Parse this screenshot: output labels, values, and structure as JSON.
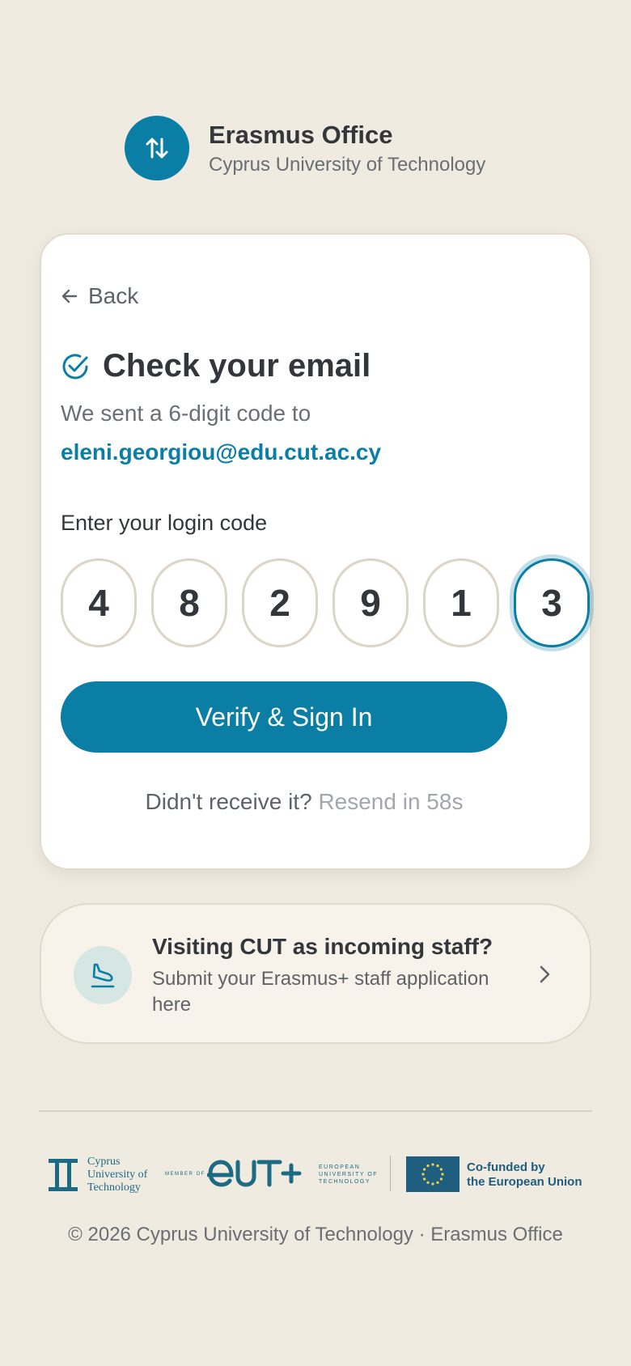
{
  "header": {
    "title": "Erasmus Office",
    "subtitle": "Cyprus University of Technology",
    "logo_icon": "arrows-up-down-icon"
  },
  "card": {
    "back_label": "Back",
    "heading": "Check your email",
    "sent_text": "We sent a 6-digit code to",
    "email": "eleni.georgiou@edu.cut.ac.cy",
    "code_label": "Enter your login code",
    "digits": [
      "4",
      "8",
      "2",
      "9",
      "1",
      "3"
    ],
    "active_digit_index": 5,
    "verify_label": "Verify & Sign In",
    "resend_prompt": "Didn't receive it?",
    "resend_timer": "Resend in 58s"
  },
  "staff_card": {
    "title": "Visiting CUT as incoming staff?",
    "description": "Submit your Erasmus+ staff application here",
    "icon": "plane-landing-icon"
  },
  "footer": {
    "cut_logo_lines": [
      "Cyprus",
      "University of",
      "Technology"
    ],
    "member_of": "MEMBER OF",
    "eut_lines": [
      "EUROPEAN",
      "UNIVERSITY OF",
      "TECHNOLOGY"
    ],
    "eu_lines": [
      "Co-funded by",
      "the European Union"
    ],
    "copyright": "© 2026 Cyprus University of Technology · Erasmus Office"
  },
  "colors": {
    "accent": "#0a7ea4",
    "background": "#efebe1",
    "card": "#ffffff"
  }
}
